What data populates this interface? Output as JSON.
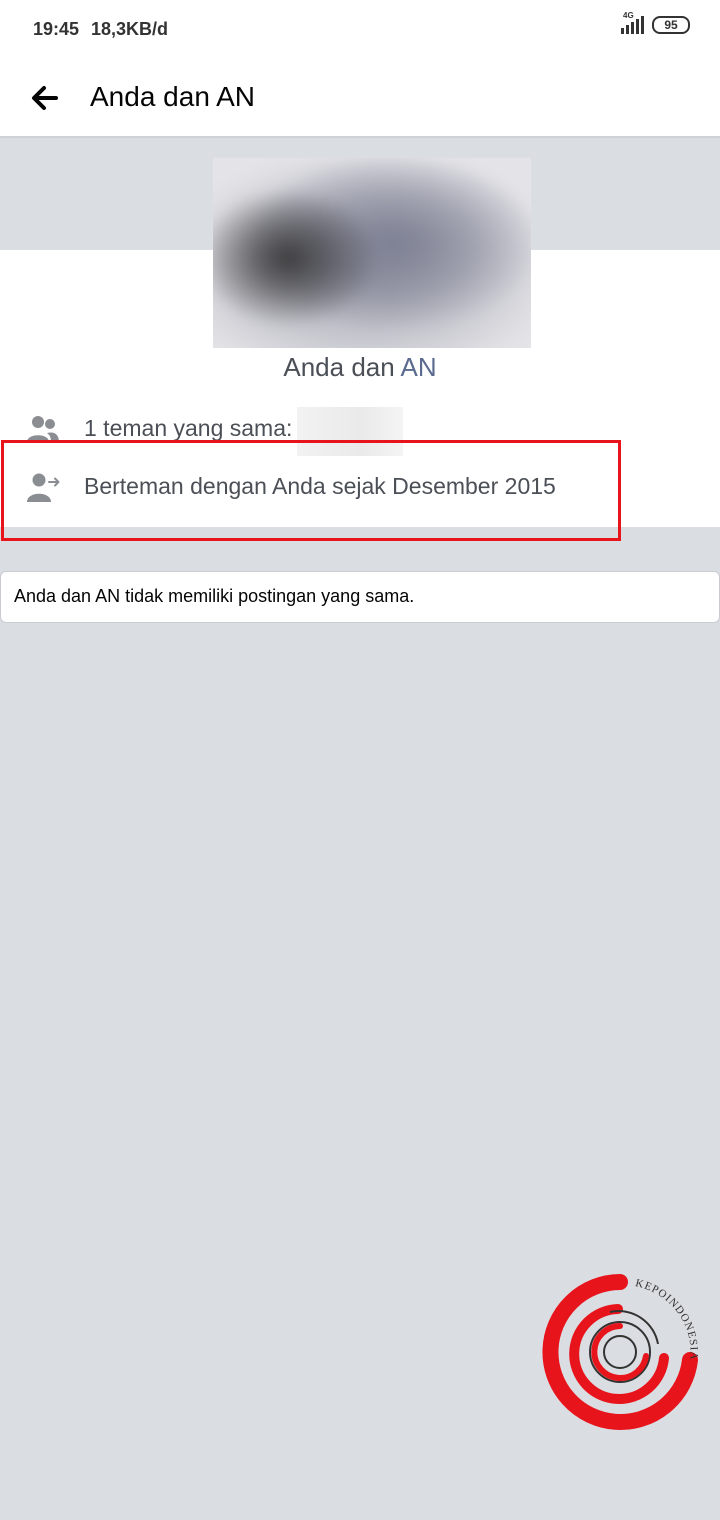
{
  "status_bar": {
    "time": "19:45",
    "speed": "18,3KB/d",
    "network": "4G",
    "battery": "95"
  },
  "header": {
    "back_icon": "arrow-left-icon",
    "title": "Anda dan AN"
  },
  "profile": {
    "name_prefix": "Anda dan ",
    "name_link": "AN",
    "mutual_friends": "1 teman yang sama:",
    "friends_since": "Berteman dengan Anda sejak Desember 2015"
  },
  "notice": {
    "text": "Anda dan AN tidak memiliki postingan yang sama."
  },
  "watermark": {
    "text": "KEPOINDONESIA"
  },
  "colors": {
    "background": "#dadde1",
    "highlight": "#e8141c",
    "link": "#5b6a8f",
    "icon": "#8a8d91"
  }
}
